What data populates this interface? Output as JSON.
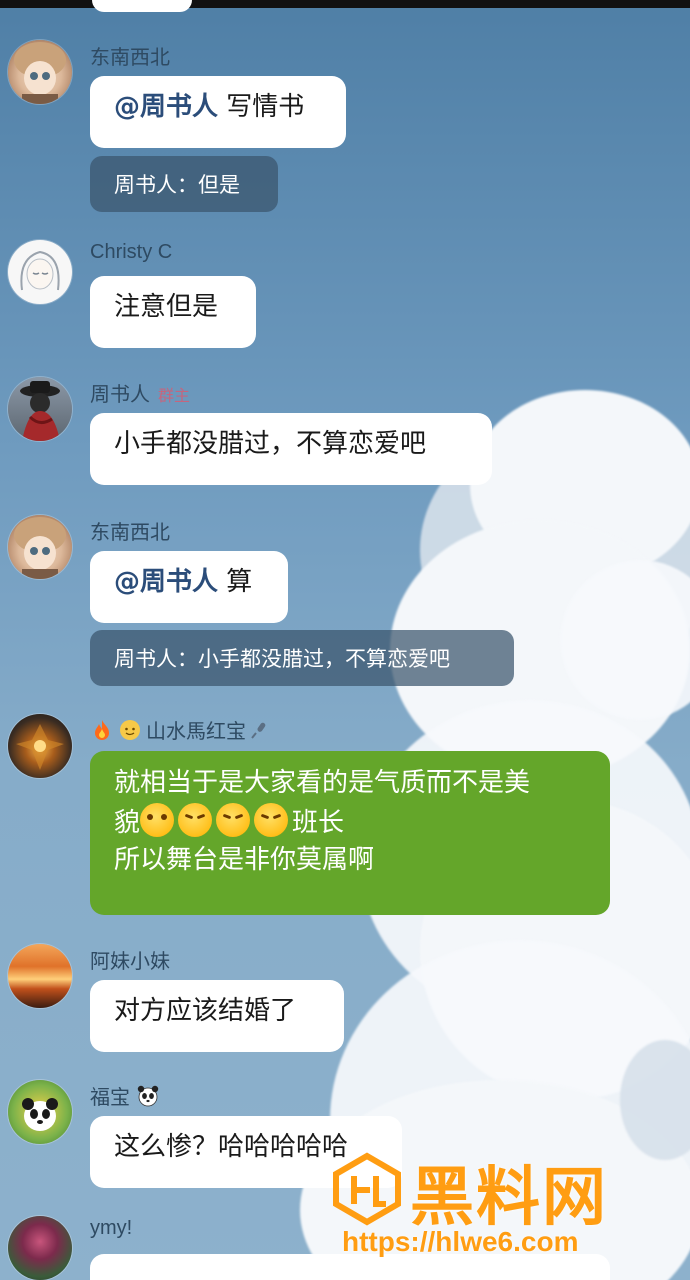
{
  "messages": [
    {
      "name": "东南西北",
      "mention": "@周书人",
      "text": "写情书",
      "quote": "周书人：但是"
    },
    {
      "name": "Christy C",
      "text": "注意但是"
    },
    {
      "name": "周书人",
      "badge": "群主",
      "text": "小手都没腊过，不算恋爱吧"
    },
    {
      "name": "东南西北",
      "mention": "@周书人",
      "text": "算",
      "quote": "周书人：小手都没腊过，不算恋爱吧"
    },
    {
      "name": "山水馬红宝",
      "line1": "就相当于是大家看的是气质而不是美",
      "line2_prefix": "貌",
      "line2_suffix": "班长",
      "line3": "所以舞台是非你莫属啊"
    },
    {
      "name": "阿妹小妹",
      "text": "对方应该结婚了"
    },
    {
      "name": "福宝",
      "text": "这么惨？哈哈哈哈哈"
    },
    {
      "name": "ymy!"
    }
  ],
  "icons": {
    "name_prefix_5": [
      "fire-icon",
      "sun-emoji-icon"
    ],
    "name_suffix_5": "microphone-icon",
    "name_suffix_7": "panda-icon",
    "emojis_5": [
      "grin-emoji",
      "angry-emoji",
      "angry-emoji",
      "angry-emoji"
    ]
  },
  "colors": {
    "bubble": "#ffffff",
    "highlight_bubble": "#64a62a",
    "quote_bg": "#3a546c",
    "badge": "#e2566b"
  },
  "watermark": {
    "text": "黑料网",
    "url": "https://hlwe6.com"
  }
}
